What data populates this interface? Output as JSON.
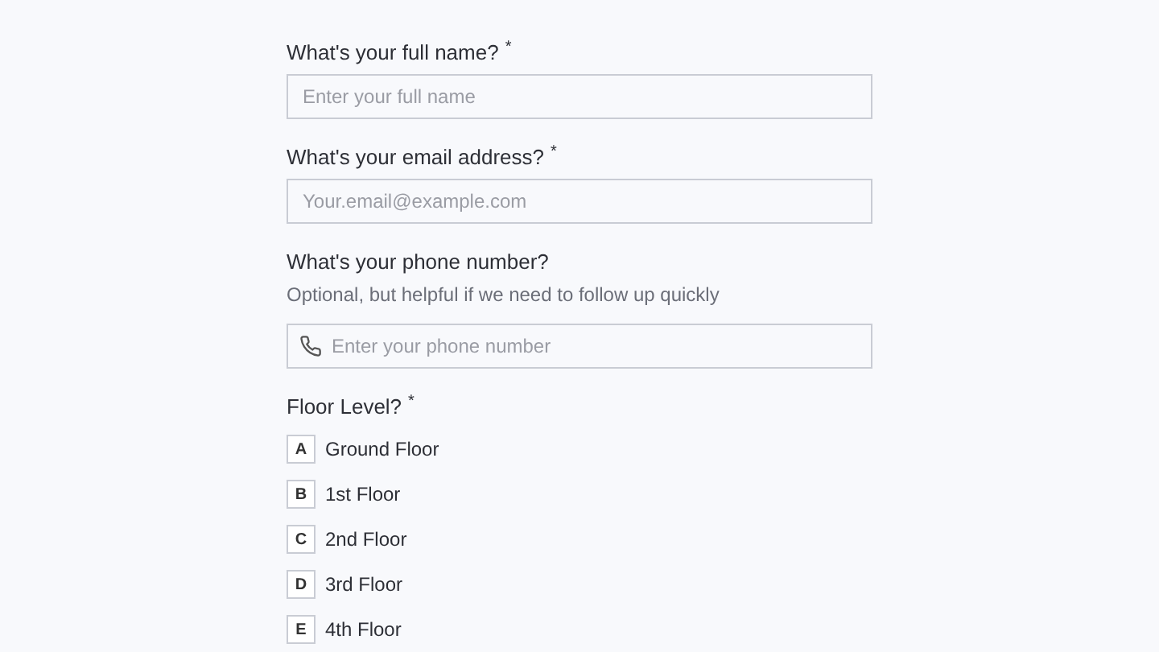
{
  "questions": [
    {
      "kind": "text",
      "label": "What's your full name?",
      "required_mark": "*",
      "placeholder": "Enter your full name"
    },
    {
      "kind": "text",
      "label": "What's your email address?",
      "required_mark": "*",
      "placeholder": "Your.email@example.com"
    },
    {
      "kind": "phone",
      "label": "What's your phone number?",
      "hint": "Optional, but helpful if we need to follow up quickly",
      "placeholder": "Enter your phone number"
    },
    {
      "kind": "choice",
      "label": "Floor Level?",
      "required_mark": "*",
      "options": [
        {
          "key": "A",
          "label": "Ground Floor"
        },
        {
          "key": "B",
          "label": "1st Floor"
        },
        {
          "key": "C",
          "label": "2nd Floor"
        },
        {
          "key": "D",
          "label": "3rd Floor"
        },
        {
          "key": "E",
          "label": "4th Floor"
        }
      ]
    }
  ]
}
